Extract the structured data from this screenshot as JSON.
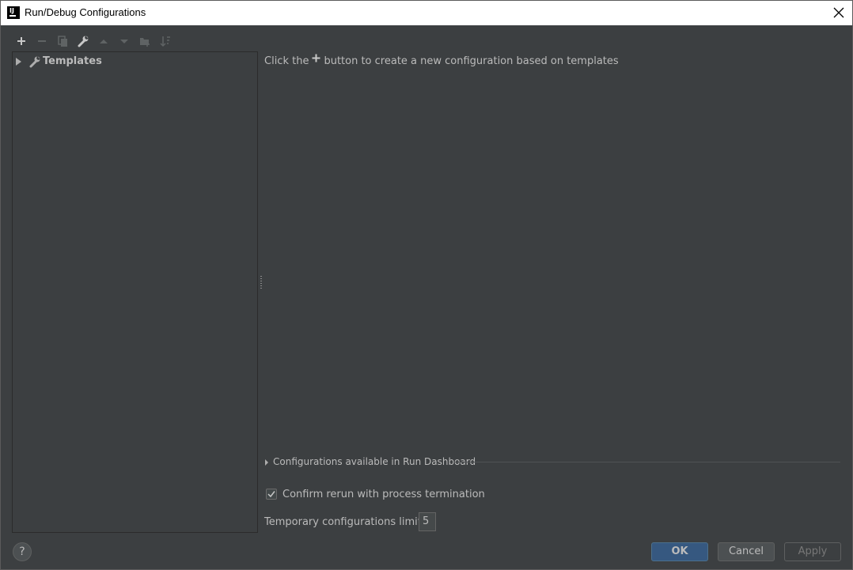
{
  "window": {
    "title": "Run/Debug Configurations",
    "app_icon_text": "IJ"
  },
  "toolbar": {
    "icons": [
      "plus-icon",
      "minus-icon",
      "copy-icon",
      "wrench-icon",
      "arrow-up-icon",
      "arrow-down-icon",
      "folder-icon",
      "sort-icon"
    ]
  },
  "tree": {
    "items": [
      {
        "label": "Templates",
        "icon": "wrench-icon"
      }
    ]
  },
  "main": {
    "hint_before": "Click the",
    "hint_after": "button to create a new configuration based on templates",
    "dashboard_label": "Configurations available in Run Dashboard",
    "confirm_label": "Confirm rerun with process termination",
    "confirm_checked": true,
    "limit_label": "Temporary configurations limit:",
    "limit_value": "5"
  },
  "footer": {
    "help_label": "?",
    "ok_label": "OK",
    "cancel_label": "Cancel",
    "apply_label": "Apply"
  },
  "colors": {
    "background": "#3c3f41",
    "text": "#bbbbbb",
    "accent": "#365880",
    "titlebar": "#ffffff"
  }
}
